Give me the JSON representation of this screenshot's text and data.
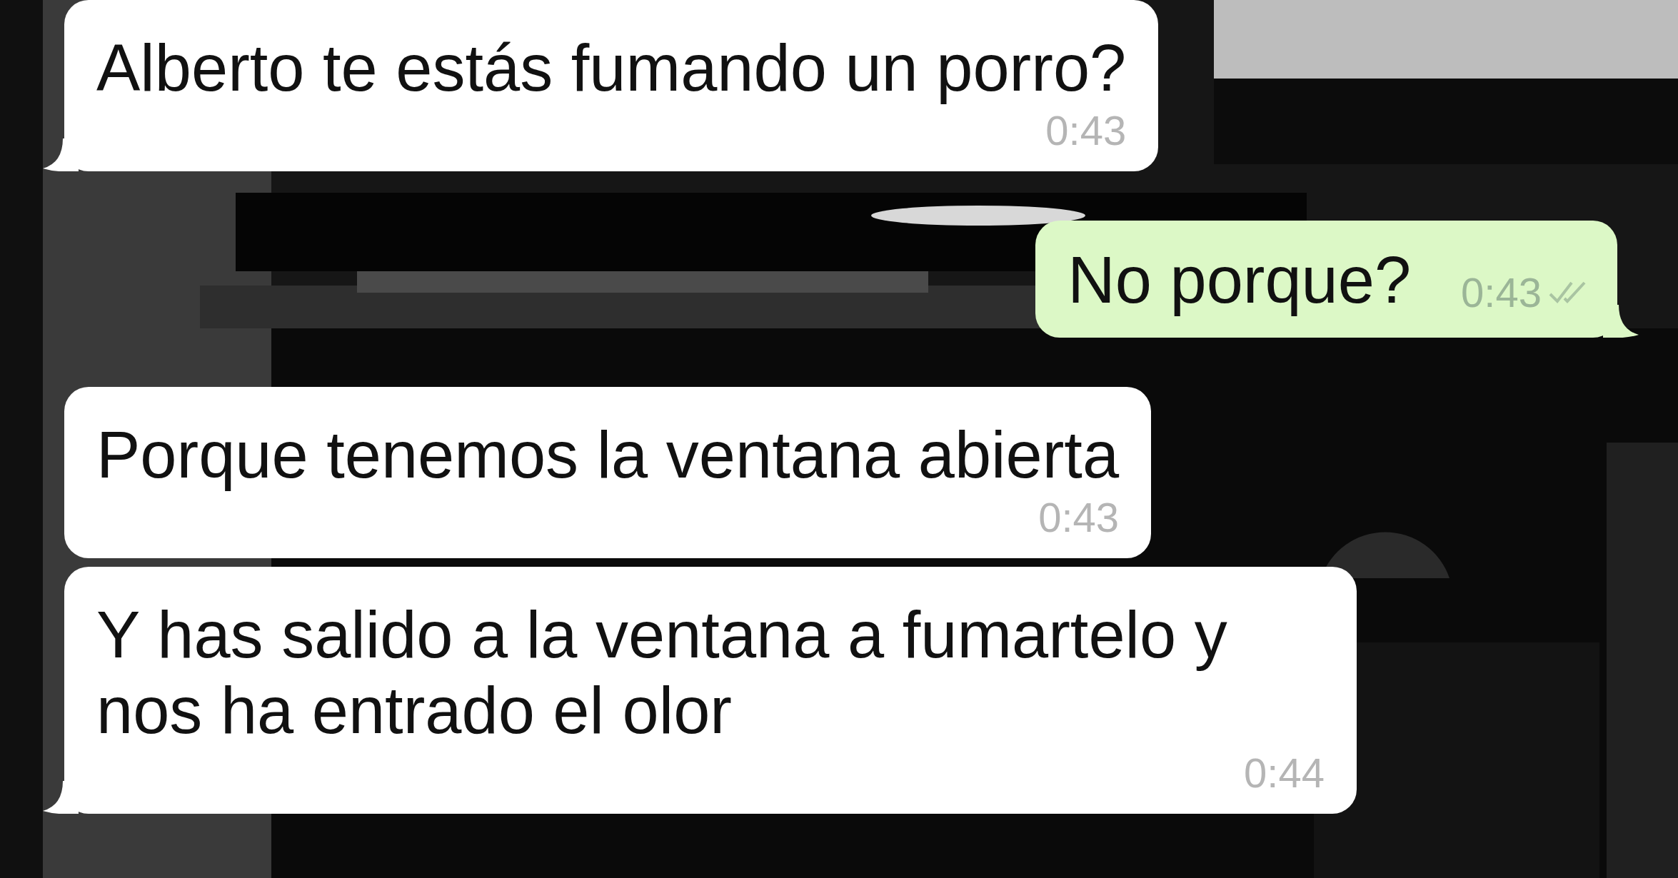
{
  "messages": [
    {
      "kind": "in",
      "text": "Alberto te estás fumando un porro?",
      "time": "0:43",
      "tail": true
    },
    {
      "kind": "out",
      "text": "No porque?",
      "time": "0:43",
      "read": false,
      "tail": true
    },
    {
      "kind": "in",
      "text": "Porque tenemos la ventana abierta",
      "time": "0:43",
      "tail": false
    },
    {
      "kind": "in",
      "text": "Y has salido a la ventana a fumartelo y nos ha entrado el olor",
      "time": "0:44",
      "tail": true
    }
  ]
}
